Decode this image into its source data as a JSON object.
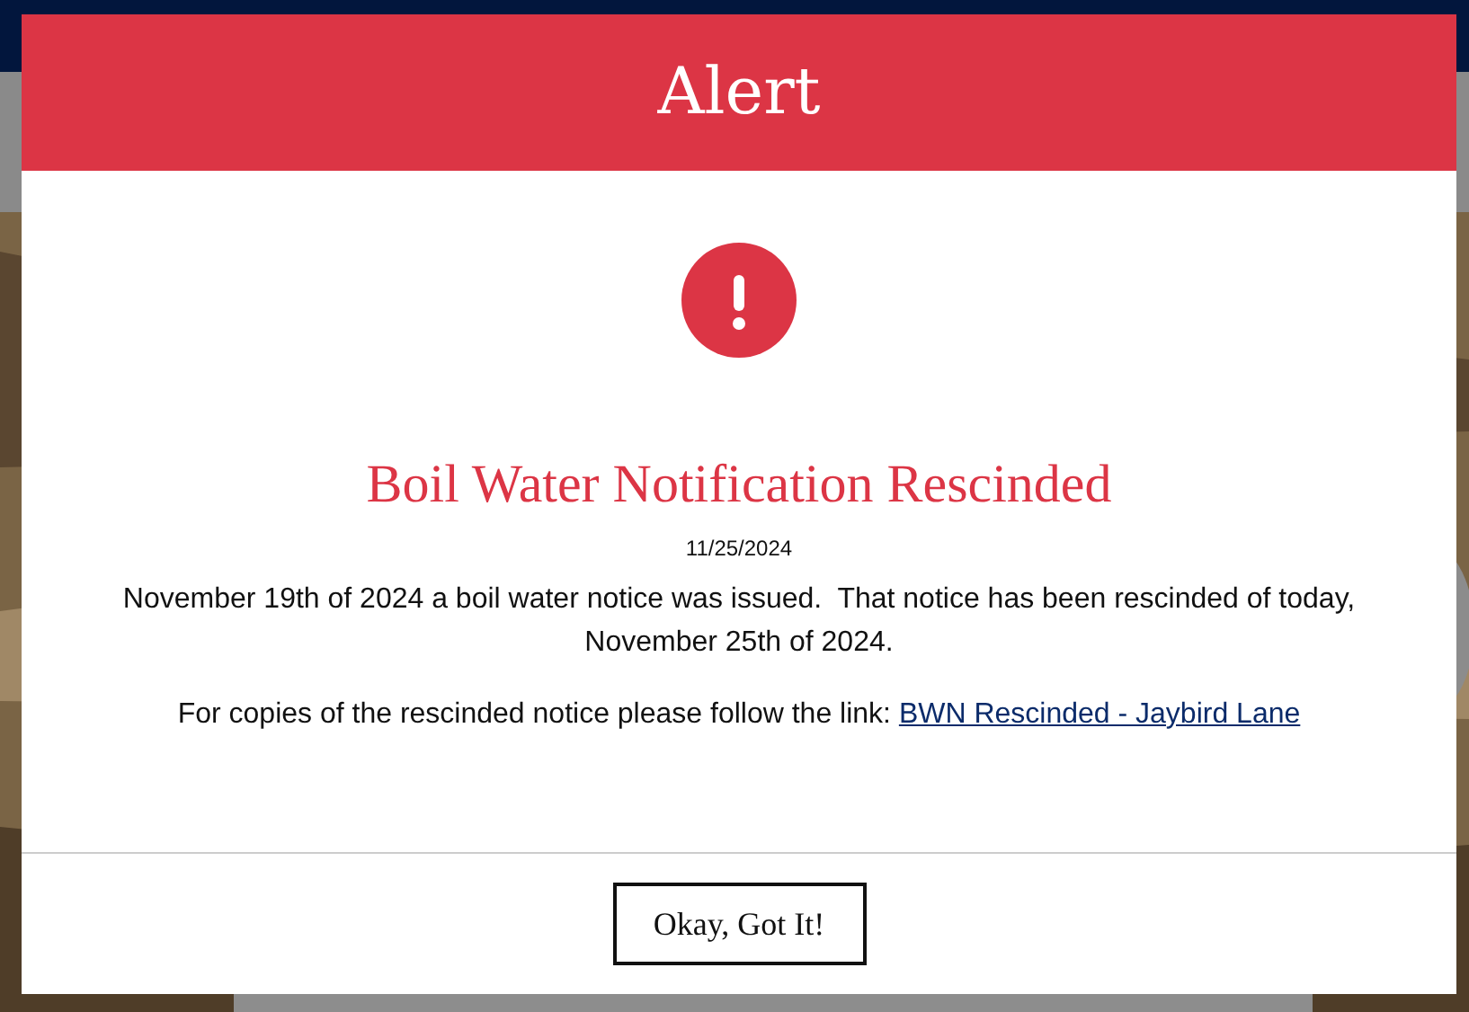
{
  "modal": {
    "title": "Alert",
    "heading": "Boil Water Notification Rescinded",
    "date": "11/25/2024",
    "paragraphs": [
      {
        "text": "November 19th of 2024 a boil water notice was issued.  That notice has been rescinded of today, November 25th of 2024."
      },
      {
        "text": "For copies of the rescinded notice please follow the link: ",
        "link": "BWN Rescinded - Jaybird Lane"
      }
    ],
    "button": "Okay, Got It!"
  }
}
